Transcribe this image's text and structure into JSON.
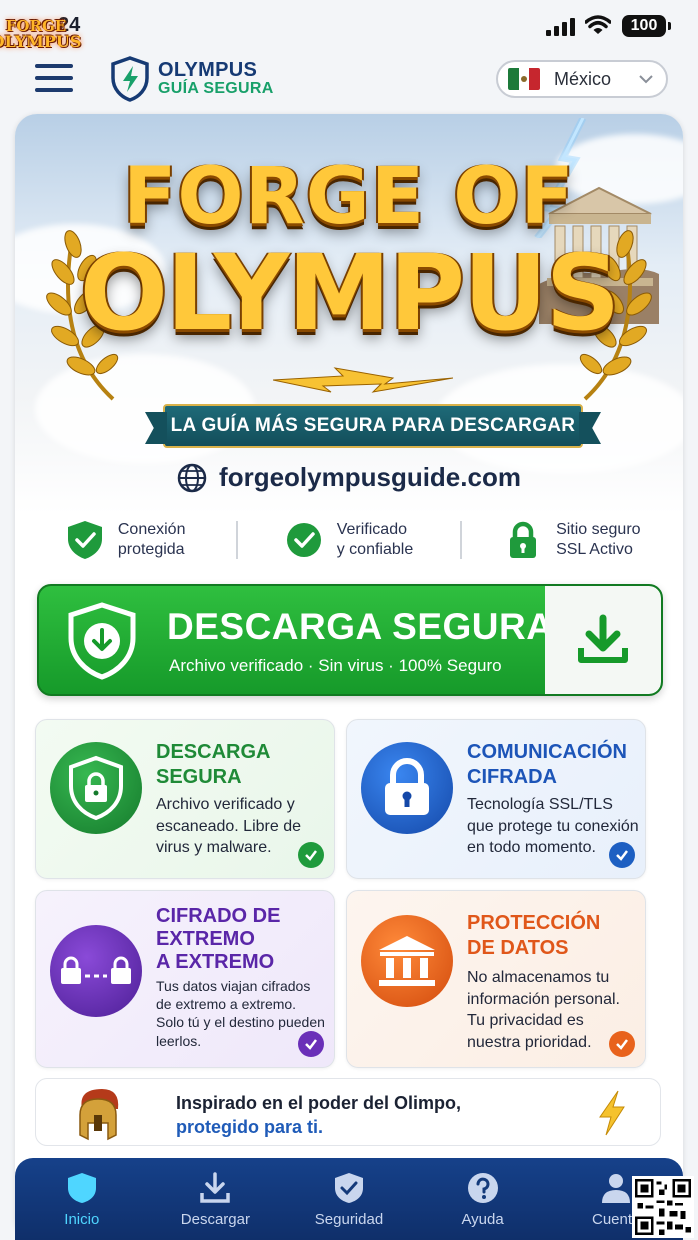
{
  "status_bar": {
    "time": "24",
    "battery": "100",
    "app_badge_line1": "FORGE",
    "app_badge_line2": "OLYMPUS"
  },
  "header": {
    "brand_name": "OLYMPUS",
    "brand_sub": "GUÍA SEGURA",
    "country": "México"
  },
  "hero": {
    "title_line1": "FORGE OF",
    "title_line2": "OLYMPUS",
    "ribbon": "LA GUÍA MÁS SEGURA PARA DESCARGAR",
    "url": "forgeolympusguide.com"
  },
  "trust": [
    {
      "line1": "Conexión",
      "line2": "protegida",
      "icon": "shield-check-icon"
    },
    {
      "line1": "Verificado",
      "line2": "y confiable",
      "icon": "check-circle-icon"
    },
    {
      "line1": "Sitio seguro",
      "line2": "SSL Activo",
      "icon": "lock-icon"
    }
  ],
  "download": {
    "title": "DESCARGA SEGURA",
    "subtitle": "Archivo verificado  ·  Sin virus  ·  100% Seguro"
  },
  "cards": [
    {
      "title_l1": "DESCARGA",
      "title_l2": "SEGURA",
      "title_l3": "",
      "body": [
        "Archivo verificado y",
        "escaneado. Libre de",
        "virus y malware."
      ],
      "color": "#1f9a3c"
    },
    {
      "title_l1": "COMUNICACIÓN",
      "title_l2": "CIFRADA",
      "title_l3": "",
      "body": [
        "Tecnología SSL/TLS",
        "que protege tu conexión",
        "en todo momento."
      ],
      "color": "#1d5fc2"
    },
    {
      "title_l1": "CIFRADO DE",
      "title_l2": "EXTREMO",
      "title_l3": "A EXTREMO",
      "body": [
        "Tus datos viajan cifrados",
        "de extremo a extremo.",
        "Solo tú y el destino pueden",
        "leerlos."
      ],
      "color": "#6a2fb8"
    },
    {
      "title_l1": "PROTECCIÓN",
      "title_l2": "DE DATOS",
      "title_l3": "",
      "body": [
        "No almacenamos tu",
        "información personal.",
        "Tu privacidad es",
        "nuestra prioridad."
      ],
      "color": "#e8621c"
    }
  ],
  "inspiration": {
    "line1": "Inspirado en el poder del Olimpo,",
    "line2": "protegido para ti."
  },
  "nav": [
    {
      "label": "Inicio",
      "icon": "shield-icon",
      "active": true
    },
    {
      "label": "Descargar",
      "icon": "download-icon",
      "active": false
    },
    {
      "label": "Seguridad",
      "icon": "shield-check-icon",
      "active": false
    },
    {
      "label": "Ayuda",
      "icon": "help-icon",
      "active": false
    },
    {
      "label": "Cuenta",
      "icon": "user-icon",
      "active": false
    }
  ]
}
